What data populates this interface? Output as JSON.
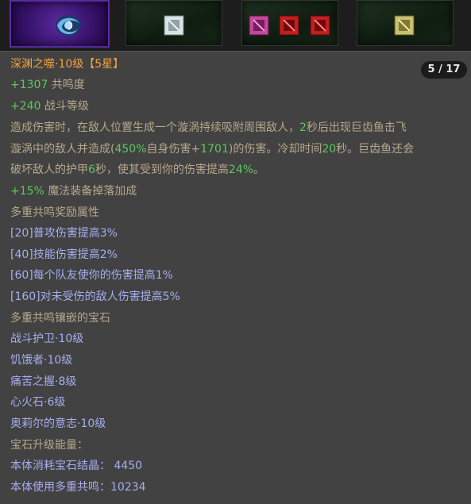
{
  "page_indicator": "5 / 17",
  "title": {
    "name": "深渊之噬·10级",
    "stars": "【5星】"
  },
  "stats": [
    {
      "value": "+1307",
      "label": "共鸣度"
    },
    {
      "value": "+240",
      "label": "战斗等级"
    }
  ],
  "description": {
    "line1_a": "造成伤害时，在敌人位置生成一个漩涡持续吸附周围敌人，",
    "line1_num": "2",
    "line1_b": "秒后出现巨齿鱼击飞",
    "line2_a": "漩涡中的敌人并造成(",
    "line2_num1": "450%",
    "line2_b": "自身伤害+",
    "line2_num2": "1701",
    "line2_c": ")的伤害。冷却时间",
    "line2_num3": "20",
    "line2_d": "秒。巨齿鱼还会",
    "line3_a": "破坏敌人的护甲",
    "line3_num1": "6",
    "line3_b": "秒，使其受到你的伤害提高",
    "line3_num2": "24%",
    "line3_c": "。"
  },
  "drop_bonus": {
    "value": "+15%",
    "label": "魔法装备掉落加成"
  },
  "resonance_header": "多重共鸣奖励属性",
  "resonance_rewards": [
    "[20]普攻伤害提高3%",
    "[40]技能伤害提高2%",
    "[60]每个队友使你的伤害提高1%",
    "[160]对未受伤的敌人伤害提高5%"
  ],
  "gems_header": "多重共鸣镶嵌的宝石",
  "gems": [
    "战斗护卫·10级",
    "饥饿者·10级",
    "痛苦之握·8级",
    "心火石·6级",
    "奥莉尔的意志·10级"
  ],
  "upgrade_header": "宝石升级能量：",
  "upgrade_lines": [
    "本体消耗宝石结晶： 4450",
    "本体使用多重共鸣：10234"
  ],
  "colors": {
    "title": "#f2a33c",
    "positive": "#5dc85d",
    "description": "#b7a88c",
    "list": "#a6aef0",
    "panel_bg": "#424242"
  },
  "socket_icons": [
    "vortex-gem-icon",
    "white-gem-icon",
    "magenta-gem-icon",
    "red-gem-icon",
    "red-gem-icon",
    "yellow-gem-icon"
  ]
}
